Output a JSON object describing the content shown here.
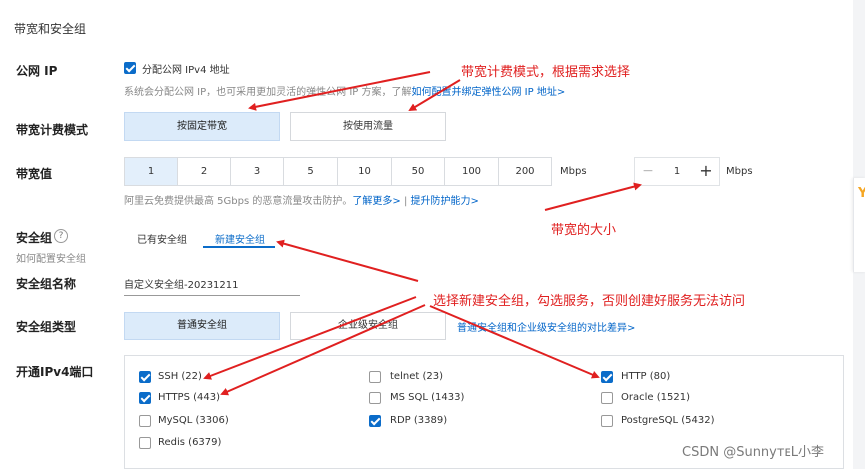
{
  "section_title": "带宽和安全组",
  "public_ip": {
    "label": "公网 IP",
    "checkbox_label": "分配公网 IPv4 地址",
    "checked": true,
    "hint": "系统会分配公网 IP，也可采用更加灵活的弹性公网 IP 方案，了解",
    "link": "如何配置并绑定弹性公网 IP 地址>"
  },
  "billing": {
    "label": "带宽计费模式",
    "options": [
      "按固定带宽",
      "按使用流量"
    ],
    "selected": "按固定带宽"
  },
  "bandwidth": {
    "label": "带宽值",
    "options": [
      "1",
      "2",
      "3",
      "5",
      "10",
      "50",
      "100",
      "200"
    ],
    "selected": "1",
    "unit": "Mbps",
    "stepper_value": "1",
    "stepper_unit": "Mbps",
    "minus": "−",
    "plus": "+",
    "hint": "阿里云免费提供最高 5Gbps 的恶意流量攻击防护。",
    "link_more": "了解更多>",
    "separator": "|",
    "link_protect": "提升防护能力>"
  },
  "security_group": {
    "label": "安全组",
    "help_icon": "?",
    "sub_hint": "如何配置安全组",
    "tabs": [
      "已有安全组",
      "新建安全组"
    ],
    "active_tab": "新建安全组",
    "name_label": "安全组名称",
    "name_value": "自定义安全组-20231211",
    "type_label": "安全组类型",
    "types": [
      "普通安全组",
      "企业级安全组"
    ],
    "selected_type": "普通安全组",
    "type_link": "普通安全组和企业级安全组的对比差异>"
  },
  "ports": {
    "label": "开通IPv4端口",
    "items": [
      {
        "name": "SSH (22)",
        "checked": true
      },
      {
        "name": "telnet (23)",
        "checked": false
      },
      {
        "name": "HTTP (80)",
        "checked": true
      },
      {
        "name": "HTTPS (443)",
        "checked": true
      },
      {
        "name": "MS SQL (1433)",
        "checked": false
      },
      {
        "name": "Oracle (1521)",
        "checked": false
      },
      {
        "name": "MySQL (3306)",
        "checked": false
      },
      {
        "name": "RDP (3389)",
        "checked": true
      },
      {
        "name": "PostgreSQL (5432)",
        "checked": false
      },
      {
        "name": "Redis (6379)",
        "checked": false
      }
    ]
  },
  "annotations": {
    "billing_note": "带宽计费模式，根据需求选择",
    "bandwidth_note": "带宽的大小",
    "security_note": "选择新建安全组，勾选服务，否则创建好服务无法访问",
    "color": "#e02020"
  },
  "watermark": "CSDN @SunnyᴛᴇL小李",
  "side_mark": "Y",
  "colors": {
    "accent": "#0b6cc9",
    "selected_bg": "#dcebfa"
  }
}
